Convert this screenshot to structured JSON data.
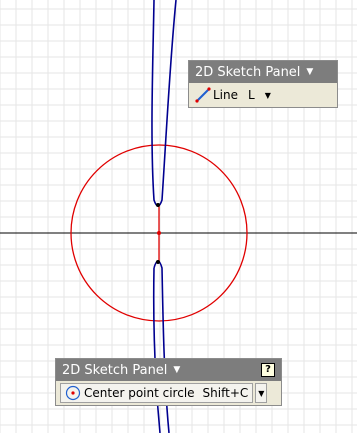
{
  "top_panel": {
    "title": "2D Sketch Panel",
    "title_arrow": "▼",
    "tool_label": "Line",
    "tool_shortcut": "L",
    "tool_dropdown": "▼",
    "tool_icon": "line-icon"
  },
  "bottom_panel": {
    "title": "2D Sketch Panel",
    "title_arrow": "▼",
    "help_label": "?",
    "tool_label": "Center point circle",
    "tool_shortcut": "Shift+C",
    "tool_dropdown": "▼",
    "tool_icon": "center-point-circle-icon"
  },
  "colors": {
    "grid": "#e6e6e6",
    "axis": "#000000",
    "circle": "#e00000",
    "profile": "#000090",
    "panel_header": "#7d7d7d",
    "panel_body": "#ece9d8"
  }
}
